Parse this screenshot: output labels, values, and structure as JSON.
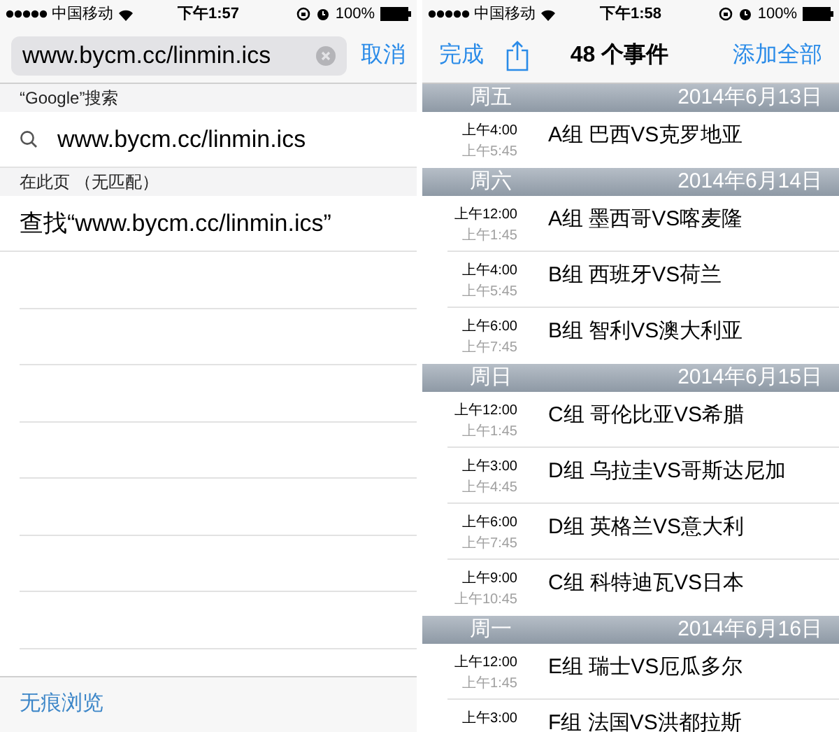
{
  "left_screen": {
    "status_bar": {
      "carrier": "中国移动",
      "time": "下午1:57",
      "battery": "100%"
    },
    "search_field": {
      "value": "www.bycm.cc/linmin.ics"
    },
    "cancel": "取消",
    "sections": [
      {
        "header": "“Google”搜索",
        "kind": "search",
        "text": "www.bycm.cc/linmin.ics"
      },
      {
        "header": "在此页 （无匹配）",
        "kind": "plain",
        "text": "查找“www.bycm.cc/linmin.ics”"
      }
    ],
    "toolbar": {
      "private": "无痕浏览"
    }
  },
  "right_screen": {
    "status_bar": {
      "carrier": "中国移动",
      "time": "下午1:58",
      "battery": "100%"
    },
    "nav": {
      "done": "完成",
      "title": "48 个事件",
      "add_all": "添加全部"
    },
    "days": [
      {
        "weekday": "周五",
        "date": "2014年6月13日",
        "events": [
          {
            "start": "上午4:00",
            "end": "上午5:45",
            "title": "A组 巴西VS克罗地亚"
          }
        ]
      },
      {
        "weekday": "周六",
        "date": "2014年6月14日",
        "events": [
          {
            "start": "上午12:00",
            "end": "上午1:45",
            "title": "A组 墨西哥VS喀麦隆"
          },
          {
            "start": "上午4:00",
            "end": "上午5:45",
            "title": "B组 西班牙VS荷兰"
          },
          {
            "start": "上午6:00",
            "end": "上午7:45",
            "title": "B组 智利VS澳大利亚"
          }
        ]
      },
      {
        "weekday": "周日",
        "date": "2014年6月15日",
        "events": [
          {
            "start": "上午12:00",
            "end": "上午1:45",
            "title": "C组 哥伦比亚VS希腊"
          },
          {
            "start": "上午3:00",
            "end": "上午4:45",
            "title": "D组 乌拉圭VS哥斯达尼加"
          },
          {
            "start": "上午6:00",
            "end": "上午7:45",
            "title": "D组 英格兰VS意大利"
          },
          {
            "start": "上午9:00",
            "end": "上午10:45",
            "title": "C组 科特迪瓦VS日本"
          }
        ]
      },
      {
        "weekday": "周一",
        "date": "2014年6月16日",
        "events": [
          {
            "start": "上午12:00",
            "end": "上午1:45",
            "title": "E组 瑞士VS厄瓜多尔"
          },
          {
            "start": "上午3:00",
            "title": "F组 法国VS洪都拉斯"
          }
        ]
      }
    ]
  }
}
